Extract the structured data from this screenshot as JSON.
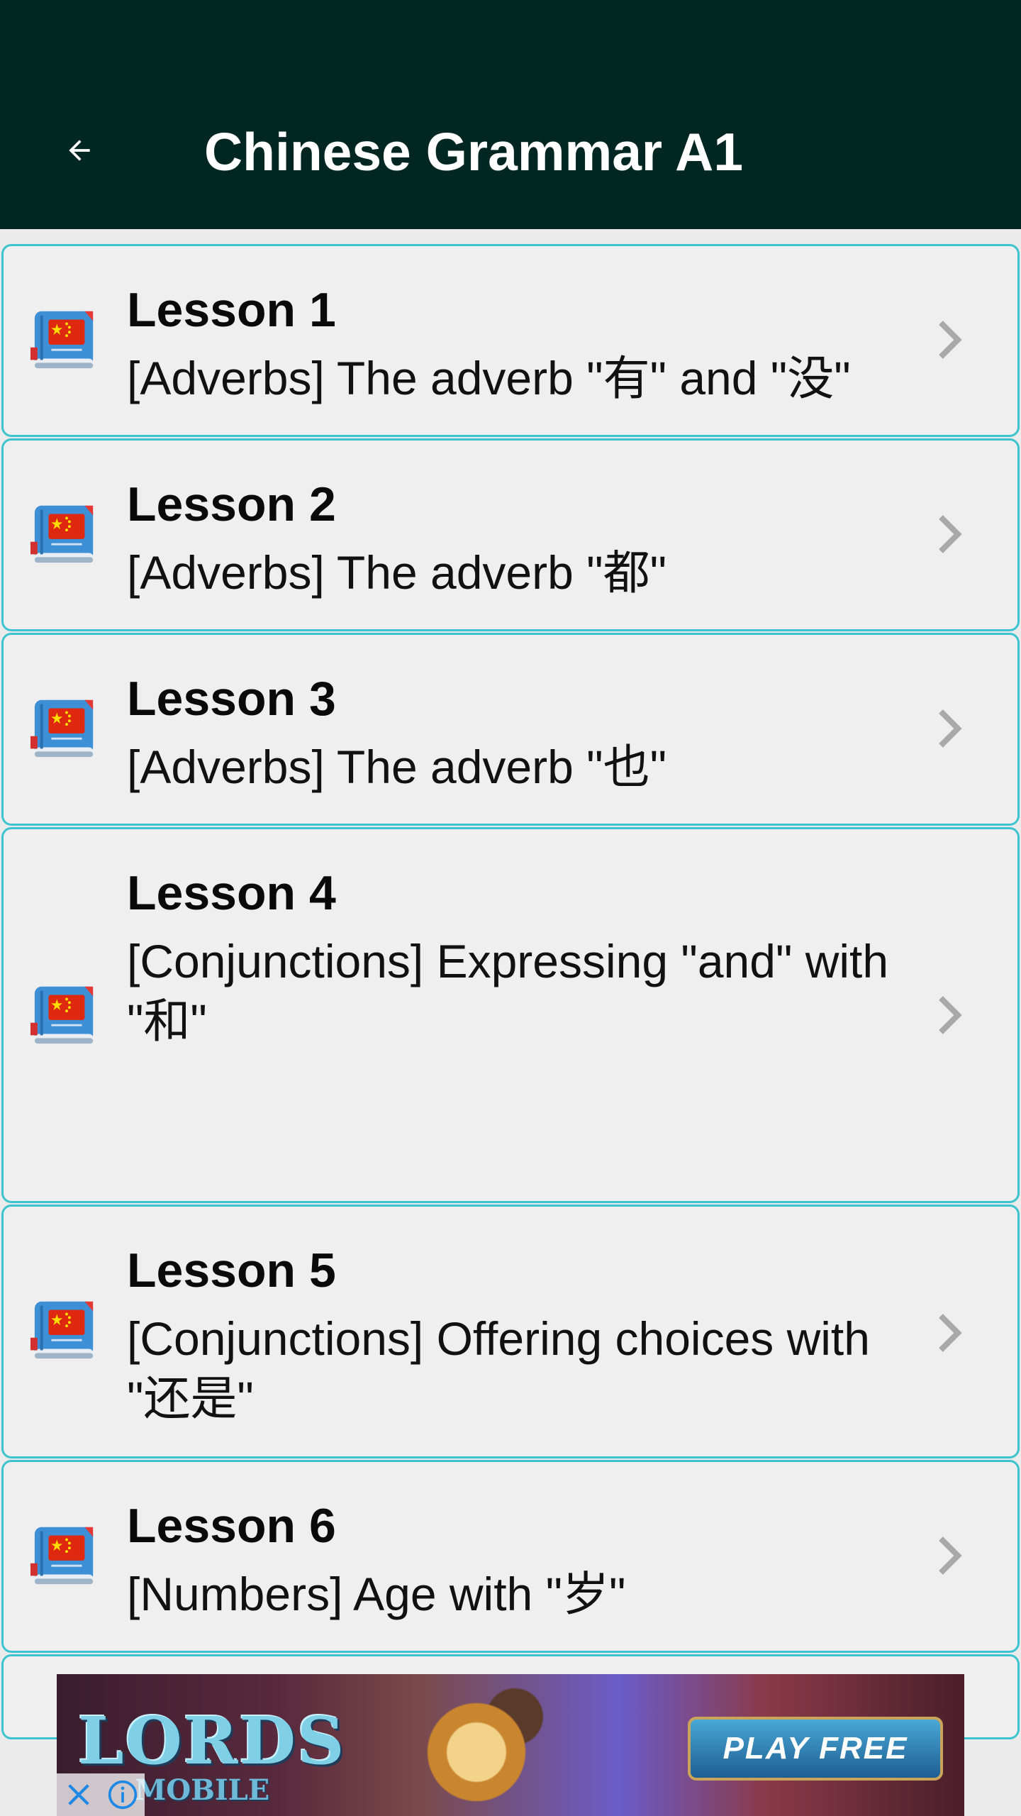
{
  "app_bar": {
    "title": "Chinese Grammar A1",
    "background": "#022722",
    "back_icon": "arrow-left-icon"
  },
  "lessons": [
    {
      "title": "Lesson 1",
      "subtitle": "[Adverbs] The adverb \"有\" and \"没\"",
      "icon": "china-flag-book-icon"
    },
    {
      "title": "Lesson 2",
      "subtitle": "[Adverbs] The adverb \"都\"",
      "icon": "china-flag-book-icon"
    },
    {
      "title": "Lesson 3",
      "subtitle": "[Adverbs] The adverb \"也\"",
      "icon": "china-flag-book-icon"
    },
    {
      "title": "Lesson 4",
      "subtitle": "[Conjunctions] Expressing \"and\" with \"和\"",
      "icon": "china-flag-book-icon"
    },
    {
      "title": "Lesson 5",
      "subtitle": "[Conjunctions] Offering choices with \"还是\"",
      "icon": "china-flag-book-icon"
    },
    {
      "title": "Lesson 6",
      "subtitle": "[Numbers] Age with \"岁\"",
      "icon": "china-flag-book-icon"
    }
  ],
  "ad": {
    "logo": "LORDS",
    "logo_sub": "MOBILE",
    "cta": "PLAY FREE",
    "close_icon": "close-icon",
    "info_icon": "info-icon"
  },
  "colors": {
    "accent_border": "#3cc3cf",
    "item_background": "#efefef",
    "chevron": "#a9a9a9"
  }
}
